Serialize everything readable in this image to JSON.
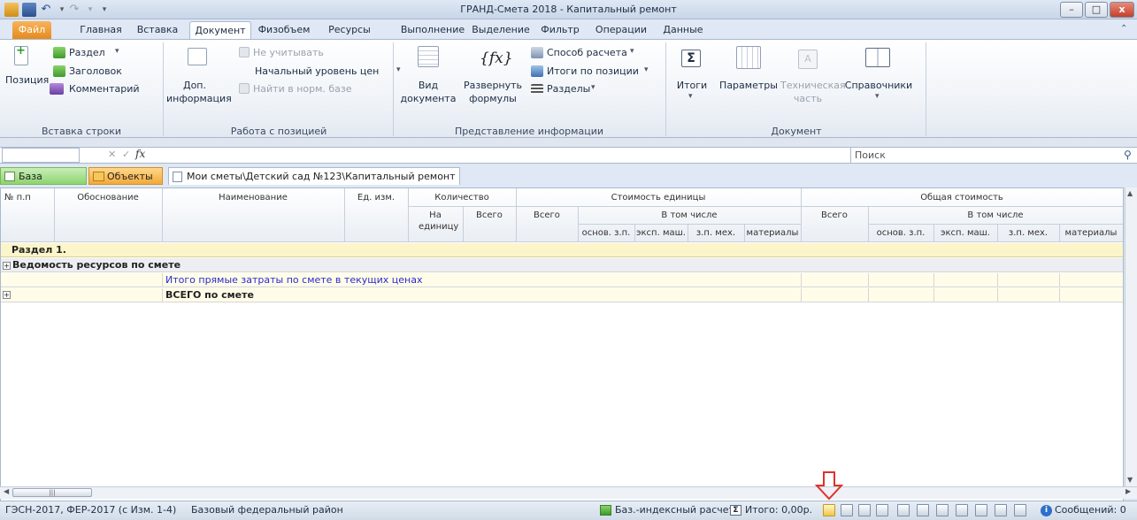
{
  "window": {
    "title": "ГРАНД-Смета 2018 - Капитальный ремонт",
    "controls": {
      "minimize": "–",
      "maximize": "□",
      "close": "x"
    }
  },
  "ribbon_tabs": [
    "Файл",
    "Главная",
    "Вставка",
    "Документ",
    "Физобъем",
    "Ресурсы",
    "Выполнение",
    "Выделение",
    "Фильтр",
    "Операции",
    "Данные"
  ],
  "ribbon": {
    "insert_row": {
      "position": "Позиция",
      "section": "Раздел",
      "heading": "Заголовок",
      "comment": "Комментарий",
      "caption": "Вставка строки"
    },
    "position_work": {
      "extra_info_1": "Доп.",
      "extra_info_2": "информация",
      "ignore": "Не учитывать",
      "price_level": "Начальный уровень цен",
      "find_norm": "Найти в норм. базе",
      "caption": "Работа с позицией"
    },
    "presentation": {
      "view_1": "Вид",
      "view_2": "документа",
      "formulas_1": "Развернуть",
      "formulas_2": "формулы",
      "calc_method": "Способ расчета",
      "position_totals": "Итоги по позиции",
      "sections": "Разделы",
      "caption": "Представление информации"
    },
    "document": {
      "totals": "Итоги",
      "params": "Параметры",
      "tech_1": "Техническая",
      "tech_2": "часть",
      "refs": "Справочники",
      "caption": "Документ"
    }
  },
  "formula_bar": {
    "cancel": "✕",
    "confirm": "✓",
    "fx": "fx"
  },
  "search": {
    "placeholder": "Поиск"
  },
  "doc_tabs": {
    "base": "База",
    "objects": "Объекты",
    "path": "Мои сметы\\Детский сад №123\\Капитальный ремонт",
    "close": "✕"
  },
  "grid": {
    "headers": {
      "num": "№ п.п",
      "basis": "Обоснование",
      "name": "Наименование",
      "unit": "Ед. изм.",
      "qty": "Количество",
      "qty_per_unit": "На единицу",
      "qty_total": "Всего",
      "unit_cost": "Стоимость единицы",
      "unit_total": "Всего",
      "incl": "В том числе",
      "main_wage": "основ. з.п.",
      "machine": "эксп. маш.",
      "mech_wage": "з.п. мех.",
      "materials": "материалы",
      "total_cost": "Общая стоимость",
      "tc_total": "Всего",
      "tc_incl": "В том числе",
      "tc_main_wage": "основ. з.п.",
      "tc_machine": "эксп. маш.",
      "tc_mech_wage": "з.п. мех.",
      "tc_materials": "материалы"
    },
    "rows": {
      "section": "Раздел 1.",
      "resources": "Ведомость ресурсов по смете",
      "direct_costs": "Итого прямые затраты по смете в текущих ценах",
      "total": "ВСЕГО по смете"
    }
  },
  "status_bar": {
    "norm_base": "ГЭСН-2017, ФЕР-2017 (с Изм. 1-4)",
    "region": "Базовый федеральный район",
    "calc_mode": "Баз.-индексный расчет",
    "total": "Итого: 0,00р.",
    "messages": "Сообщений: 0"
  },
  "colors": {
    "section_row": "#fbf5c9",
    "direct_costs_text": "#2a2ad0",
    "arrow": "#e0322a"
  }
}
